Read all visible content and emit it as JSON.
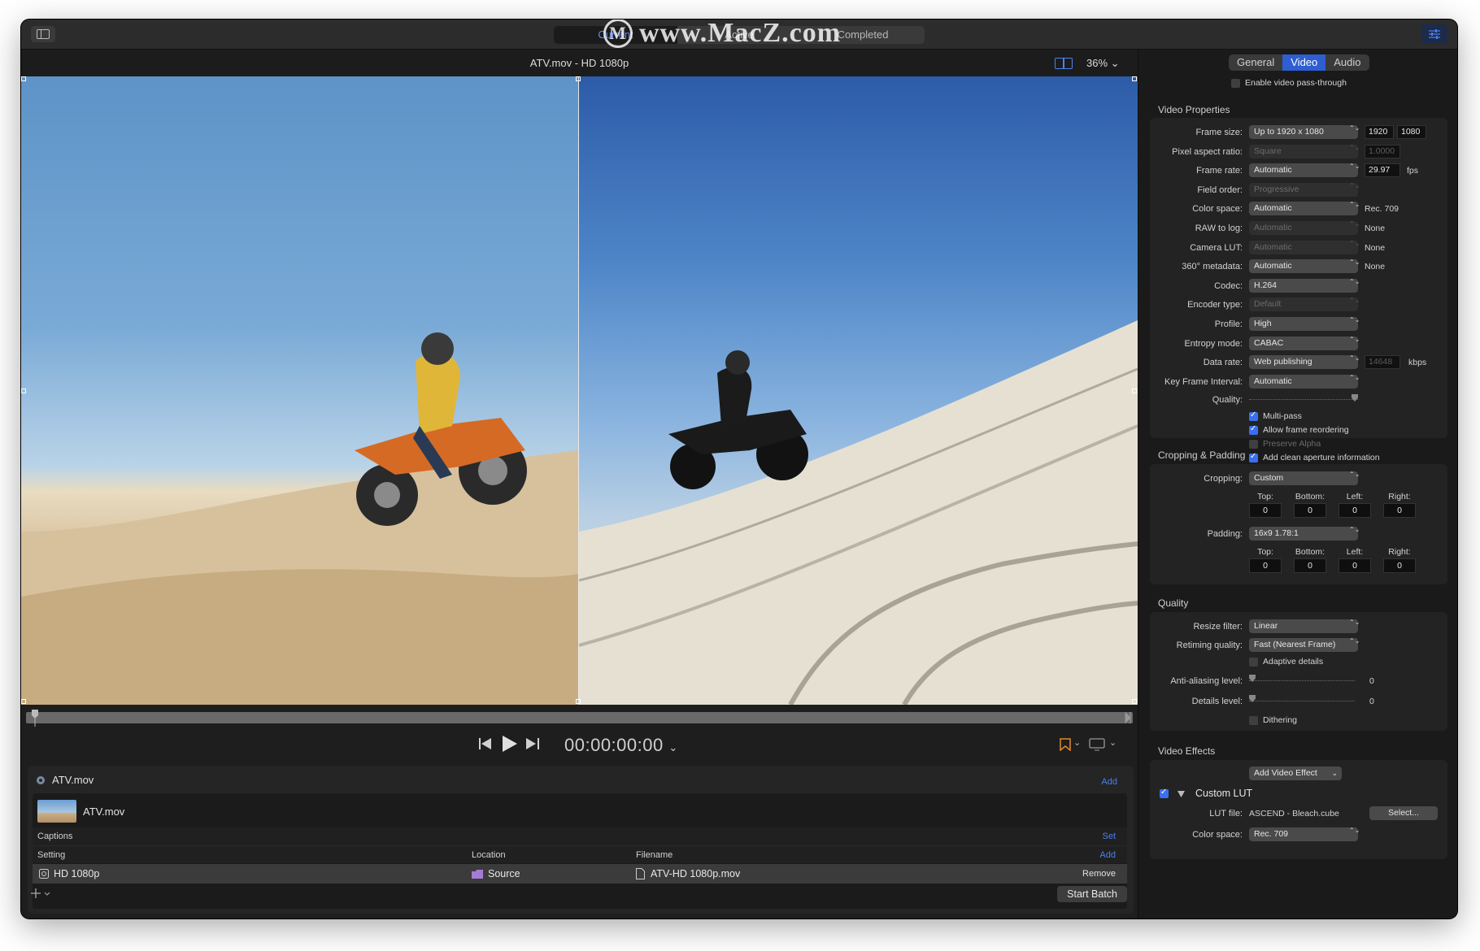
{
  "watermark": "www.MacZ.com",
  "toolbar": {
    "segments": [
      "Current",
      "Active",
      "Completed"
    ],
    "selected": "Current"
  },
  "viewer": {
    "title": "ATV.mov - HD 1080p",
    "zoom": "36%"
  },
  "transport": {
    "timecode": "00:00:00:00"
  },
  "batch": {
    "source_name": "ATV.mov",
    "add_label": "Add",
    "clip_name": "ATV.mov",
    "captions_label": "Captions",
    "captions_action": "Set",
    "columns": [
      "Setting",
      "Location",
      "Filename"
    ],
    "columns_action": "Add",
    "job": {
      "setting": "HD 1080p",
      "location": "Source",
      "filename": "ATV-HD 1080p.mov",
      "action": "Remove"
    },
    "start_batch": "Start Batch"
  },
  "inspector": {
    "tabs": [
      "General",
      "Video",
      "Audio"
    ],
    "selected_tab": "Video",
    "passthrough": "Enable video pass-through",
    "video_properties": {
      "title": "Video Properties",
      "rows": [
        {
          "label": "Frame size:",
          "value": "Up to 1920 x 1080",
          "dim": false,
          "f1": "1920",
          "f2": "1080"
        },
        {
          "label": "Pixel aspect ratio:",
          "value": "Square",
          "dim": true,
          "f1": "1.0000"
        },
        {
          "label": "Frame rate:",
          "value": "Automatic",
          "dim": false,
          "f1": "29.97",
          "unit": "fps"
        },
        {
          "label": "Field order:",
          "value": "Progressive",
          "dim": true
        },
        {
          "label": "Color space:",
          "value": "Automatic",
          "dim": false,
          "note": "Rec. 709"
        },
        {
          "label": "RAW to log:",
          "value": "Automatic",
          "dim": true,
          "note": "None"
        },
        {
          "label": "Camera LUT:",
          "value": "Automatic",
          "dim": true,
          "note": "None"
        },
        {
          "label": "360° metadata:",
          "value": "Automatic",
          "dim": false,
          "note": "None"
        },
        {
          "label": "Codec:",
          "value": "H.264",
          "dim": false
        },
        {
          "label": "Encoder type:",
          "value": "Default",
          "dim": true
        },
        {
          "label": "Profile:",
          "value": "High",
          "dim": false
        },
        {
          "label": "Entropy mode:",
          "value": "CABAC",
          "dim": false
        },
        {
          "label": "Data rate:",
          "value": "Web publishing",
          "dim": false,
          "f1": "14648",
          "unit": "kbps"
        },
        {
          "label": "Key Frame Interval:",
          "value": "Automatic",
          "dim": false
        }
      ],
      "quality_label": "Quality:",
      "checks": [
        {
          "label": "Multi-pass",
          "on": true
        },
        {
          "label": "Allow frame reordering",
          "on": true
        },
        {
          "label": "Preserve Alpha",
          "on": false,
          "dim": true
        },
        {
          "label": "Add clean aperture information",
          "on": true
        }
      ]
    },
    "cropping": {
      "title": "Cropping & Padding",
      "cropping_label": "Cropping:",
      "cropping_value": "Custom",
      "padding_label": "Padding:",
      "padding_value": "16x9 1.78:1",
      "edges": [
        "Top:",
        "Bottom:",
        "Left:",
        "Right:"
      ],
      "crop_values": [
        "0",
        "0",
        "0",
        "0"
      ],
      "pad_values": [
        "0",
        "0",
        "0",
        "0"
      ]
    },
    "quality": {
      "title": "Quality",
      "resize_label": "Resize filter:",
      "resize_value": "Linear",
      "retiming_label": "Retiming quality:",
      "retiming_value": "Fast (Nearest Frame)",
      "adaptive": "Adaptive details",
      "antialias_label": "Anti-aliasing level:",
      "antialias_value": "0",
      "details_label": "Details level:",
      "details_value": "0",
      "dithering": "Dithering"
    },
    "effects": {
      "title": "Video Effects",
      "add_button": "Add Video Effect",
      "effect_name": "Custom LUT",
      "lut_label": "LUT file:",
      "lut_value": "ASCEND - Bleach.cube",
      "select_button": "Select...",
      "colorspace_label": "Color space:",
      "colorspace_value": "Rec. 709"
    }
  }
}
